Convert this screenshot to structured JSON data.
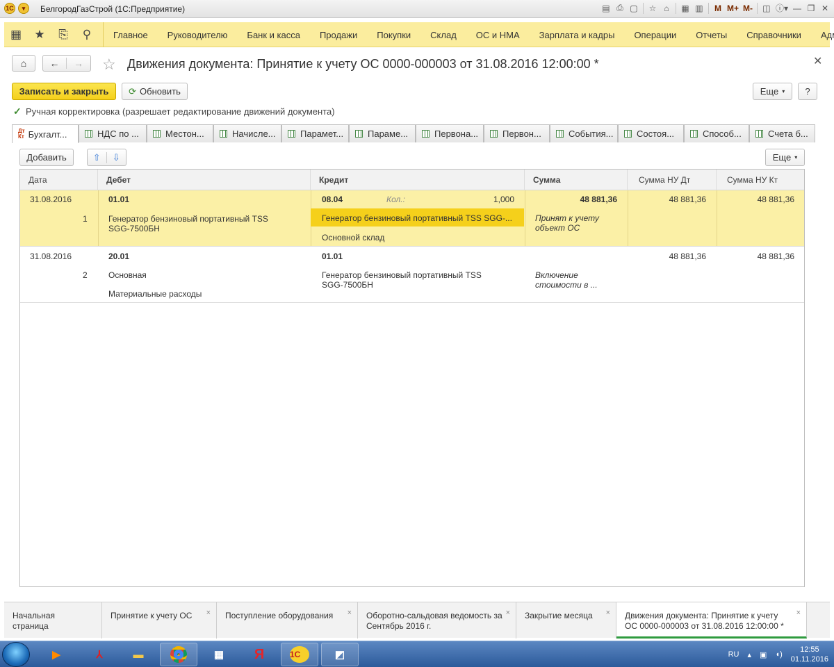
{
  "window": {
    "title": "БелгородГазСтрой  (1С:Предприятие)",
    "toolbar_m": [
      "M",
      "M+",
      "M-"
    ]
  },
  "sections": [
    "Главное",
    "Руководителю",
    "Банк и касса",
    "Продажи",
    "Покупки",
    "Склад",
    "ОС и НМА",
    "Зарплата и кадры",
    "Операции",
    "Отчеты",
    "Справочники",
    "Адми"
  ],
  "form": {
    "title": "Движения документа: Принятие к учету ОС 0000-000003 от 31.08.2016 12:00:00 *",
    "save_close": "Записать и закрыть",
    "refresh": "Обновить",
    "more": "Еще",
    "help": "?",
    "manual_check": "Ручная корректировка (разрешает редактирование движений документа)"
  },
  "tabs": [
    "Бухгалт...",
    "НДС по ...",
    "Местон...",
    "Начисле...",
    "Парамет...",
    "Параме...",
    "Первона...",
    "Первон...",
    "События...",
    "Состоя...",
    "Способ...",
    "Счета б..."
  ],
  "table_toolbar": {
    "add": "Добавить",
    "more": "Еще"
  },
  "columns": [
    "Дата",
    "Дебет",
    "Кредит",
    "Сумма",
    "Сумма НУ Дт",
    "Сумма НУ Кт"
  ],
  "rows": [
    {
      "date": "31.08.2016",
      "num": "1",
      "debit_acc": "01.01",
      "debit_sub1": "Генератор бензиновый портативный TSS SGG-7500БН",
      "debit_sub2": "",
      "credit_acc": "08.04",
      "qty_label": "Кол.:",
      "qty": "1,000",
      "credit_sub1": "Генератор бензиновый портативный TSS SGG-...",
      "credit_sub2": "Основной склад",
      "sum": "48 881,36",
      "content": "Принят к учету объект ОС",
      "nu_dt": "48 881,36",
      "nu_kt": "48 881,36"
    },
    {
      "date": "31.08.2016",
      "num": "2",
      "debit_acc": "20.01",
      "debit_sub1": "Основная",
      "debit_sub2": "Материальные расходы",
      "credit_acc": "01.01",
      "credit_sub1": "Генератор бензиновый портативный TSS SGG-7500БН",
      "content": "Включение стоимости в ...",
      "nu_dt": "48 881,36",
      "nu_kt": "48 881,36"
    }
  ],
  "open_windows": [
    "Начальная страница",
    "Принятие к учету ОС",
    "Поступление оборудования",
    "Оборотно-сальдовая ведомость за Сентябрь 2016 г.",
    "Закрытие месяца",
    "Движения документа: Принятие к учету ОС 0000-000003 от 31.08.2016 12:00:00 *"
  ],
  "taskbar": {
    "lang": "RU",
    "time": "12:55",
    "date": "01.11.2016",
    "yandex": "Я",
    "onec": "1С"
  },
  "colors": {
    "accent": "#f5d01b",
    "section_bar": "#fbed9e",
    "selected_row": "#fbf0a6"
  }
}
